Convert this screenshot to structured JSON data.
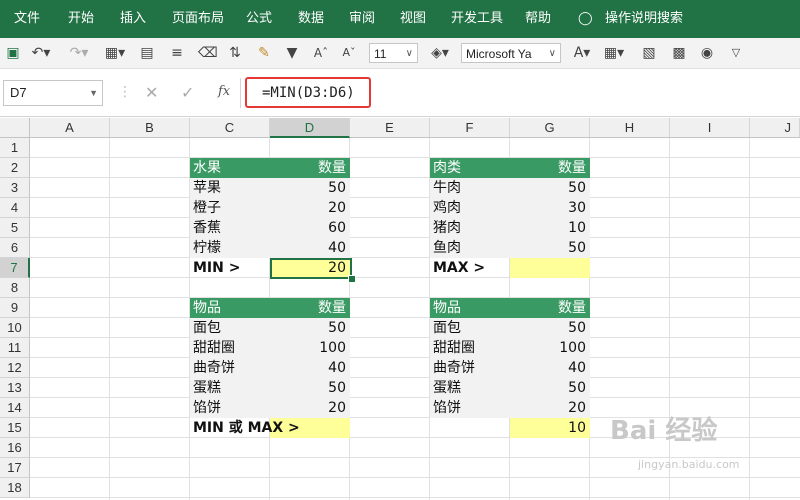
{
  "ribbon": {
    "tabs": [
      "文件",
      "开始",
      "插入",
      "页面布局",
      "公式",
      "数据",
      "审阅",
      "视图",
      "开发工具",
      "帮助"
    ],
    "tell_me": "操作说明搜索"
  },
  "toolbar": {
    "font_size": "11",
    "font_name": "Microsoft Ya"
  },
  "formula_bar": {
    "name_box": "D7",
    "formula": "=MIN(D3:D6)",
    "fx_label": "fx"
  },
  "columns": [
    "A",
    "B",
    "C",
    "D",
    "E",
    "F",
    "G",
    "H",
    "I",
    "J"
  ],
  "rows": [
    "1",
    "2",
    "3",
    "4",
    "5",
    "6",
    "7",
    "8",
    "9",
    "10",
    "11",
    "12",
    "13",
    "14",
    "15",
    "16",
    "17",
    "18"
  ],
  "table_fruit": {
    "header_label": "水果",
    "header_qty": "数量",
    "rows": [
      [
        "苹果",
        "50"
      ],
      [
        "橙子",
        "20"
      ],
      [
        "香蕉",
        "60"
      ],
      [
        "柠檬",
        "40"
      ]
    ],
    "result_label": "MIN >",
    "result_value": "20"
  },
  "table_meat": {
    "header_label": "肉类",
    "header_qty": "数量",
    "rows": [
      [
        "牛肉",
        "50"
      ],
      [
        "鸡肉",
        "30"
      ],
      [
        "猪肉",
        "10"
      ],
      [
        "鱼肉",
        "50"
      ]
    ],
    "result_label": "MAX >",
    "result_value": ""
  },
  "table_items_left": {
    "header_label": "物品",
    "header_qty": "数量",
    "rows": [
      [
        "面包",
        "50"
      ],
      [
        "甜甜圈",
        "100"
      ],
      [
        "曲奇饼",
        "40"
      ],
      [
        "蛋糕",
        "50"
      ],
      [
        "馅饼",
        "20"
      ]
    ],
    "result_label": "MIN 或 MAX >"
  },
  "table_items_right": {
    "header_label": "物品",
    "header_qty": "数量",
    "rows": [
      [
        "面包",
        "50"
      ],
      [
        "甜甜圈",
        "100"
      ],
      [
        "曲奇饼",
        "40"
      ],
      [
        "蛋糕",
        "50"
      ],
      [
        "馅饼",
        "20"
      ]
    ],
    "result_value": "10"
  },
  "watermark": {
    "main": "Bai 经验",
    "sub": "jingyan.baidu.com"
  },
  "colors": {
    "ribbon": "#217346",
    "table_header": "#3a9a64",
    "highlight": "#ffff99",
    "formula_outline": "#e53935"
  },
  "icons": [
    "save-icon",
    "undo-icon",
    "redo-icon",
    "borders-icon",
    "merge-icon",
    "align-icon",
    "clear-icon",
    "sort-icon",
    "paint-icon",
    "filter-icon",
    "font-grow-icon",
    "font-shrink-icon",
    "fill-color-icon",
    "font-color-icon",
    "format-icon",
    "table-icon",
    "camera-icon",
    "more-icon",
    "lightbulb-icon"
  ]
}
